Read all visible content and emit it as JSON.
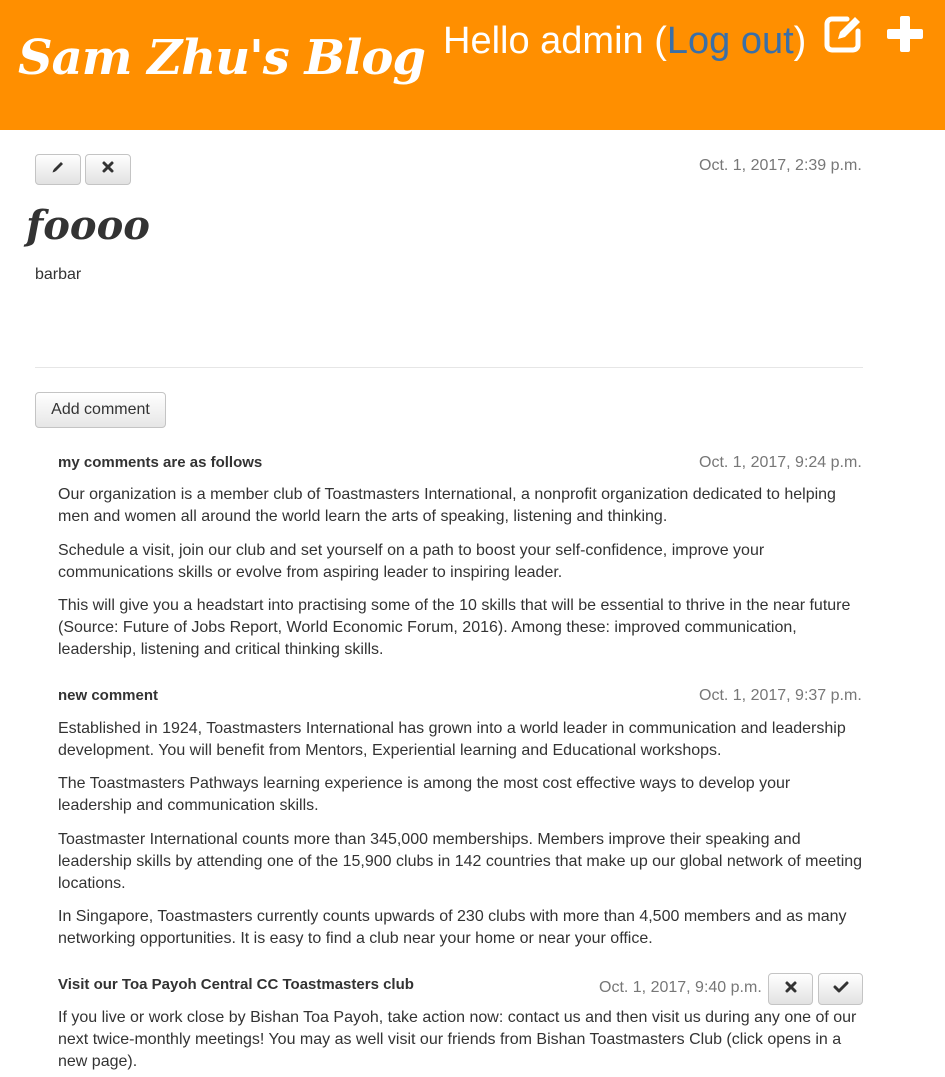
{
  "header": {
    "brand": "Sam Zhu's Blog",
    "greeting_prefix": "Hello admin (",
    "logout_label": "Log out",
    "greeting_suffix": ")",
    "icons": [
      "edit-square-icon",
      "plus-icon"
    ]
  },
  "post": {
    "date": "Oct. 1, 2017, 2:39 p.m.",
    "title": "foooo",
    "body": "barbar",
    "actions": [
      "pencil-icon",
      "close-icon"
    ]
  },
  "add_comment_label": "Add comment",
  "comments": [
    {
      "title": "my comments are as follows",
      "date": "Oct. 1, 2017, 9:24 p.m.",
      "paragraphs": [
        "Our organization is a member club of Toastmasters International, a nonprofit organization dedicated to helping men and women all around the world learn the arts of speaking, listening and thinking.",
        "Schedule a visit, join our club and set yourself on a path to boost your self-confidence, improve your communications skills or evolve from aspiring leader to inspiring leader.",
        "This will give you a headstart into practising some of the 10 skills that will be essential to thrive in the near future (Source: Future of Jobs Report, World Economic Forum, 2016). Among these: improved communication, leadership, listening and critical thinking skills."
      ]
    },
    {
      "title": "new comment",
      "date": "Oct. 1, 2017, 9:37 p.m.",
      "paragraphs": [
        "Established in 1924, Toastmasters International has grown into a world leader in communication and leadership development. You will benefit from Mentors, Experiential learning and Educational workshops.",
        "The Toastmasters Pathways learning experience is among the most cost effective ways to develop your leadership and communication skills.",
        "Toastmaster International counts more than 345,000 memberships. Members improve their speaking and leadership skills by attending one of the 15,900 clubs in 142 countries that make up our global network of meeting locations.",
        "In Singapore, Toastmasters currently counts upwards of 230 clubs with more than 4,500 members and as many networking opportunities. It is easy to find a club near your home or near your office."
      ]
    },
    {
      "title": "Visit our Toa Payoh Central CC Toastmasters club",
      "date": "Oct. 1, 2017, 9:40 p.m.",
      "actions": [
        "close-icon",
        "checkmark-icon"
      ],
      "paragraphs": [
        "If you live or work close by Bishan Toa Payoh, take action now: contact us and then visit us during any one of our next twice-monthly meetings! You may as well visit our friends from Bishan Toastmasters Club (click opens in a new page)."
      ]
    }
  ],
  "colors": {
    "header_bg": "#ff8f00",
    "link": "#3a6fa8",
    "text": "#333333",
    "muted": "#777777"
  }
}
